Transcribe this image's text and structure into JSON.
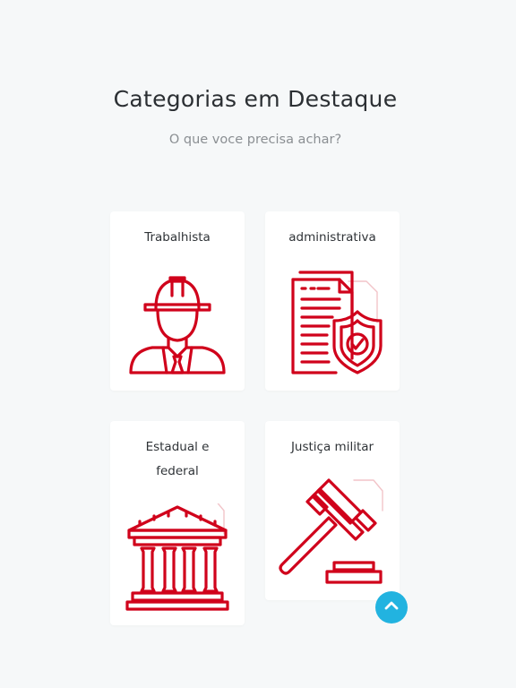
{
  "section": {
    "title": "Categorias em Destaque",
    "subtitle": "O que voce precisa achar?"
  },
  "categories": [
    {
      "label": "Trabalhista",
      "icon": "worker-helmet-icon"
    },
    {
      "label": "administrativa",
      "icon": "document-shield-icon"
    },
    {
      "label": "Estadual e federal",
      "label_line1": "Estadual e",
      "label_line2": "federal",
      "icon": "courthouse-icon"
    },
    {
      "label": "Justiça militar",
      "icon": "gavel-icon"
    }
  ],
  "colors": {
    "icon_red": "#d0021b",
    "scroll_button": "#22b3e0",
    "background": "#f6f8f9"
  },
  "scroll_top": {
    "icon": "chevron-up-icon"
  }
}
